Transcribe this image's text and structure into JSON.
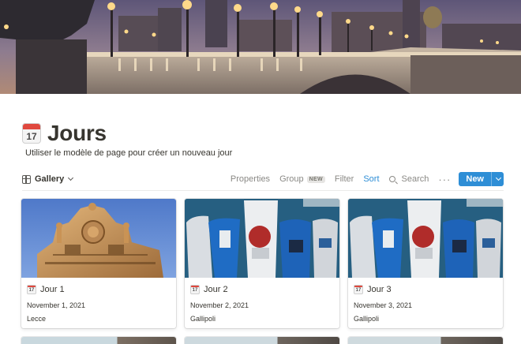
{
  "cover": {
    "icon": "bridge-night-cover-image"
  },
  "page": {
    "icon_day": "17",
    "title": "Jours",
    "description": "Utiliser le modèle de page pour créer un nouveau jour"
  },
  "toolbar": {
    "view_label": "Gallery",
    "properties_label": "Properties",
    "group_label": "Group",
    "group_badge": "NEW",
    "filter_label": "Filter",
    "sort_label": "Sort",
    "search_label": "Search",
    "more_label": "···",
    "new_label": "New",
    "accent": "#2e8ed6"
  },
  "cards": [
    {
      "name": "Jour 1",
      "date": "November 1, 2021",
      "place": "Lecce",
      "image": "baroque-facade-image"
    },
    {
      "name": "Jour 2",
      "date": "November 2, 2021",
      "place": "Gallipoli",
      "image": "harbor-boats-image"
    },
    {
      "name": "Jour 3",
      "date": "November 3, 2021",
      "place": "Gallipoli",
      "image": "harbor-boats-image"
    }
  ]
}
